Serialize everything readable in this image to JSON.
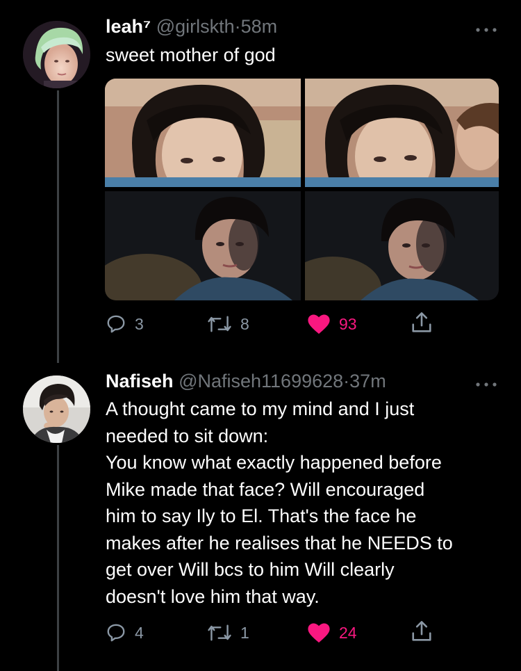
{
  "tweets": [
    {
      "display_name": "leah⁷",
      "handle": "@girlskth",
      "separator": "·",
      "time": "58m",
      "text_lines": [
        "sweet mother of god"
      ],
      "more_icon": "more-dots-icon",
      "stats": {
        "replies": "3",
        "retweets": "8",
        "likes": "93"
      },
      "liked": true
    },
    {
      "display_name": "Nafiseh",
      "handle": "@Nafiseh11699628",
      "separator": "·",
      "time": "37m",
      "text_lines": [
        "A thought came to my mind and I just",
        "needed to sit down:",
        "You know what exactly happened before",
        "Mike made that face? Will encouraged",
        "him to say Ily to El. That's the face he",
        "makes after he realises that he NEEDS to",
        "get over Will bcs to him Will clearly",
        "doesn't love him that way."
      ],
      "more_icon": "more-dots-icon",
      "stats": {
        "replies": "4",
        "retweets": "1",
        "likes": "24"
      },
      "liked": true
    }
  ],
  "colors": {
    "background": "#000000",
    "text": "#ffffff",
    "secondary": "#71767b",
    "like": "#f91880",
    "thread_line": "#3d4144"
  },
  "icons": {
    "reply": "reply-icon",
    "retweet": "retweet-icon",
    "like": "heart-icon",
    "share": "share-icon"
  }
}
